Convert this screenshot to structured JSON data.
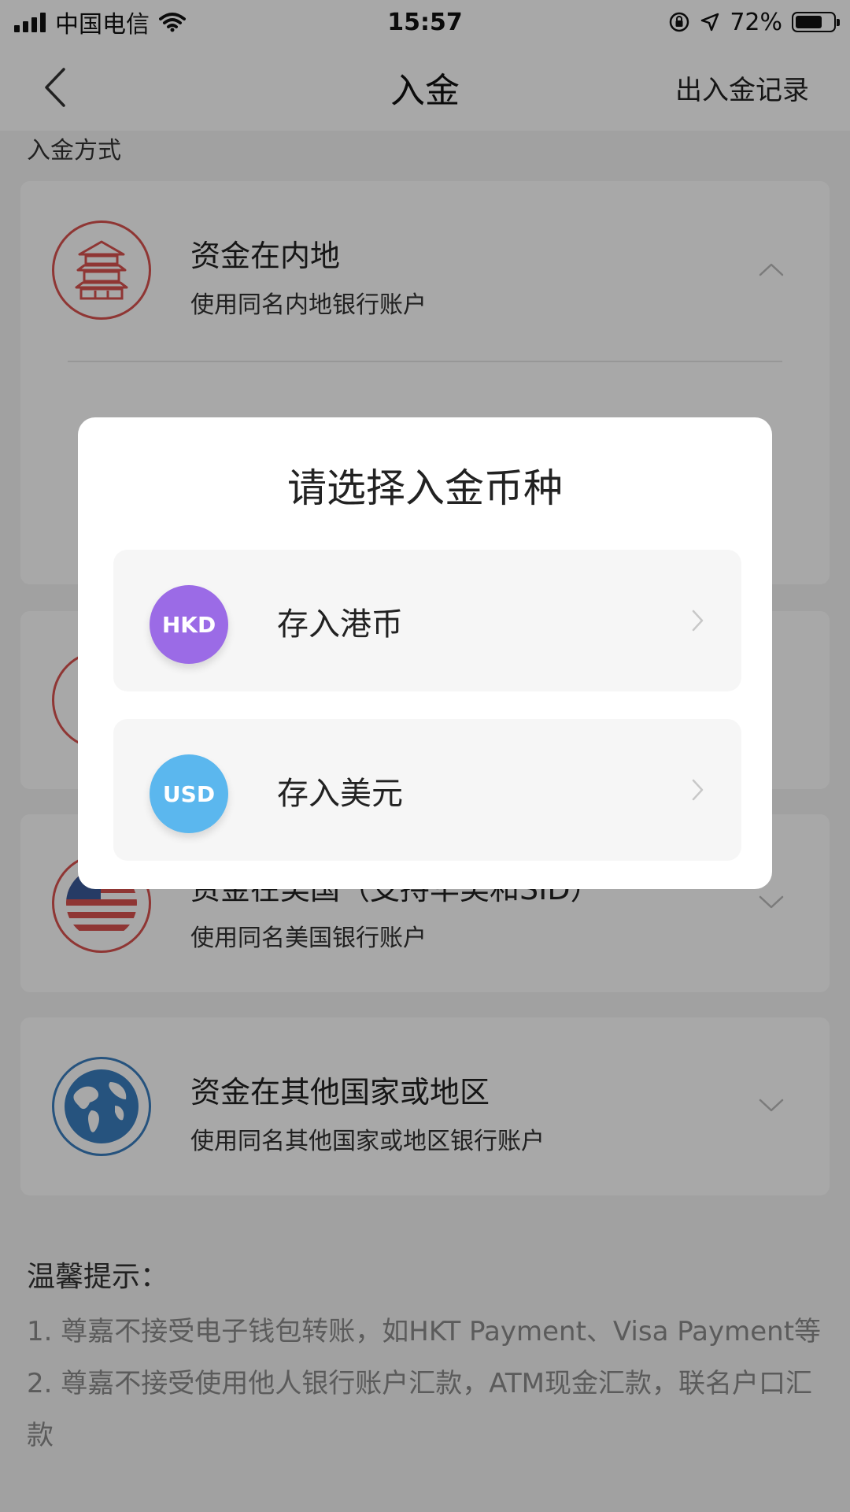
{
  "status_bar": {
    "carrier": "中国电信",
    "time": "15:57",
    "battery": "72%"
  },
  "navbar": {
    "title": "入金",
    "right_link": "出入金记录"
  },
  "section": {
    "title": "入金方式"
  },
  "cards": [
    {
      "title": "资金在内地",
      "subtitle": "使用同名内地银行账户"
    },
    {
      "title": "资金在美国（支持华美和SID）",
      "subtitle": "使用同名美国银行账户"
    },
    {
      "title": "资金在其他国家或地区",
      "subtitle": "使用同名其他国家或地区银行账户"
    }
  ],
  "tips": {
    "title": "温馨提示：",
    "items": [
      "1. 尊嘉不接受电子钱包转账，如HKT Payment、Visa Payment等",
      "2. 尊嘉不接受使用他人银行账户汇款，ATM现金汇款，联名户口汇款"
    ]
  },
  "modal": {
    "title": "请选择入金币种",
    "options": [
      {
        "code": "HKD",
        "label": "存入港币",
        "color": "#9b6be6"
      },
      {
        "code": "USD",
        "label": "存入美元",
        "color": "#5bb7ee"
      }
    ]
  },
  "colors": {
    "emblem_red": "#d9534f",
    "emblem_blue": "#3a7ebf"
  }
}
